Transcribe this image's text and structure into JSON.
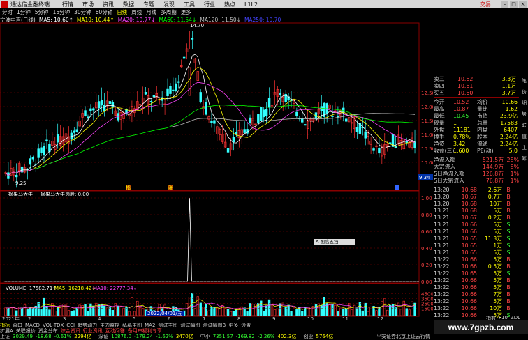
{
  "app": {
    "title": "通达信金融终端"
  },
  "menu": [
    "行情",
    "市场",
    "资讯",
    "数据",
    "专题",
    "发现",
    "工具",
    "行业",
    "热点",
    "L1L2"
  ],
  "menu_right": "交易",
  "periods": [
    "分时",
    "1分钟",
    "5分钟",
    "15分钟",
    "30分钟",
    "60分钟",
    "日线",
    "周线",
    "月线",
    "多周期",
    "更多"
  ],
  "active_period": "日线",
  "info": {
    "title": "宁波中百(日线)",
    "ma5": "MA5: 10.60↑",
    "ma10": "MA10: 10.44↑",
    "ma20": "MA20: 10.77↓",
    "ma60": "MA60: 11.54↓",
    "ma120": "MA120: 11.50↓",
    "ma250": "MA250: 10.70"
  },
  "colors": {
    "up": "#ff3333",
    "down": "#33ffff",
    "ma5": "#ffffff",
    "ma10": "#ffff00",
    "ma20": "#ff44ff",
    "ma60": "#00ff00",
    "ma120": "#bbbbbb",
    "grid": "#8a0000",
    "yellow": "#ffff00"
  },
  "price_axis": [
    "12.50",
    "12.00",
    "11.50",
    "11.00",
    "10.50",
    "10.00"
  ],
  "price_high_label": "14.70",
  "price_low_label": "9.25",
  "last_price_tag": "9.34",
  "signal_text": "摘果马大牛",
  "signal_text2": "摘果马大牛选股: 0.00",
  "signal_axis": [
    "1.00",
    "0.80",
    "0.60",
    "0.40",
    "0.20",
    "0.00"
  ],
  "tooltip": "A 图高五挡",
  "volume_info": {
    "label": "VOLUME: 17582.71↑",
    "ma5": "MA5: 16218.42↓",
    "ma10": "MA10: 22777.34↓"
  },
  "volume_axis": [
    "45000",
    "35000",
    "25000",
    "15000"
  ],
  "date_label": "2022/04/01/五",
  "year_label": "2021年",
  "axis_months": [
    "2",
    "3",
    "4",
    "5",
    "6",
    "7",
    "8",
    "9",
    "10",
    "11",
    "12"
  ],
  "marker_labels": {
    "m1": "指",
    "m2": "涨"
  },
  "quote_top": [
    {
      "label": "卖三",
      "price": "10.62",
      "vol": "3.3万"
    },
    {
      "label": "卖四",
      "price": "10.61",
      "vol": "1.1万"
    },
    {
      "label": "买五",
      "price": "10.60",
      "vol": "3.7万"
    }
  ],
  "quote_stats": [
    {
      "l1": "今开",
      "v1": "10.52",
      "l2": "均价",
      "v2": "10.66"
    },
    {
      "l1": "最高",
      "v1": "10.87",
      "l2": "量比",
      "v2": "1.62"
    },
    {
      "l1": "最低",
      "v1": "10.45",
      "l2": "市值",
      "v2": "23.9亿"
    },
    {
      "l1": "现量",
      "v1": "1",
      "l2": "总量",
      "v2": "17583"
    },
    {
      "l1": "外盘",
      "v1": "11181",
      "l2": "内盘",
      "v2": "6407"
    },
    {
      "l1": "换手",
      "v1": "0.78%",
      "l2": "股本",
      "v2": "2.24亿"
    },
    {
      "l1": "净资",
      "v1": "3.42",
      "l2": "流通",
      "v2": "2.24亿"
    },
    {
      "l1": "收益(三)",
      "v1": "1.600",
      "l2": "PE(动)",
      "v2": "5.0"
    }
  ],
  "fund_flow": [
    {
      "label": "净流入额",
      "value": "521.5万",
      "pct": "28%"
    },
    {
      "label": "大宗流入",
      "value": "144.9万",
      "pct": "8%"
    },
    {
      "label": "5日净流入额",
      "value": "126.8万",
      "pct": "1%"
    },
    {
      "label": "5日大宗流入",
      "value": "76.8万",
      "pct": "1%"
    }
  ],
  "trades": [
    {
      "time": "13:20",
      "price": "10.68",
      "vol": "2.6万",
      "side": "B"
    },
    {
      "time": "13:20",
      "price": "10.67",
      "vol": "0.7万",
      "side": "B"
    },
    {
      "time": "13:20",
      "price": "10.68",
      "vol": "10万",
      "side": "B"
    },
    {
      "time": "13:21",
      "price": "10.68",
      "vol": "5万",
      "side": "B"
    },
    {
      "time": "13:21",
      "price": "10.67",
      "vol": "0.2万",
      "side": "B"
    },
    {
      "time": "13:21",
      "price": "10.66",
      "vol": "5万",
      "side": "S"
    },
    {
      "time": "13:21",
      "price": "10.66",
      "vol": "5万",
      "side": "S"
    },
    {
      "time": "13:21",
      "price": "10.65",
      "vol": "11.3万",
      "side": "S"
    },
    {
      "time": "13:21",
      "price": "10.65",
      "vol": "1万",
      "side": "S"
    },
    {
      "time": "13:21",
      "price": "10.65",
      "vol": "5万",
      "side": "S"
    },
    {
      "time": "13:22",
      "price": "10.66",
      "vol": "5万",
      "side": "B"
    },
    {
      "time": "13:22",
      "price": "10.66",
      "vol": "0.5万",
      "side": "B"
    },
    {
      "time": "13:22",
      "price": "10.65",
      "vol": "5万",
      "side": "S"
    },
    {
      "time": "13:22",
      "price": "10.66",
      "vol": "5万",
      "side": "B"
    },
    {
      "time": "13:22",
      "price": "10.66",
      "vol": "5万",
      "side": "B"
    },
    {
      "time": "13:22",
      "price": "10.66",
      "vol": "7万",
      "side": "B"
    },
    {
      "time": "13:22",
      "price": "10.66",
      "vol": "5万",
      "side": "B"
    },
    {
      "time": "13:22",
      "price": "10.66",
      "vol": "10万",
      "side": "B"
    },
    {
      "time": "13:22",
      "price": "10.66",
      "vol": "5万",
      "side": "S"
    }
  ],
  "side_tabs": [
    "笔",
    "价",
    "细",
    "势",
    "联",
    "值",
    "主",
    "筹"
  ],
  "panel_tabs": [
    "指数",
    "F10",
    "ZDL"
  ],
  "bottom_tabs": [
    "指标",
    "窗口",
    "MACD",
    "VOL-TDX",
    "CCI",
    "趋势动力",
    "主力监控",
    "私募主图",
    "MA2",
    "测试主图",
    "测试幅图",
    "测试幅图B",
    "更多",
    "设置"
  ],
  "bottom_tabs2": [
    "扩展A",
    "关联报价",
    "资金分布",
    "综合资讯",
    "行业资讯",
    "互动问答",
    "备用户福利专享"
  ],
  "status": [
    {
      "name": "上证",
      "value": "3029.49",
      "chg": "-18.68",
      "pct": "-0.61%",
      "amt": "2294亿"
    },
    {
      "name": "深证",
      "value": "10876.0",
      "chg": "-179.24",
      "pct": "-1.62%",
      "amt": "3470亿"
    },
    {
      "name": "中小",
      "value": "7351.57",
      "chg": "-169.82",
      "pct": "-2.26%",
      "amt": "402.3亿"
    },
    {
      "name": "创业",
      "value": "",
      "chg": "",
      "pct": "",
      "amt": "5764亿"
    }
  ],
  "status_right": "平安证券北京上证云行情",
  "watermark": "www.7gpzb.com"
}
